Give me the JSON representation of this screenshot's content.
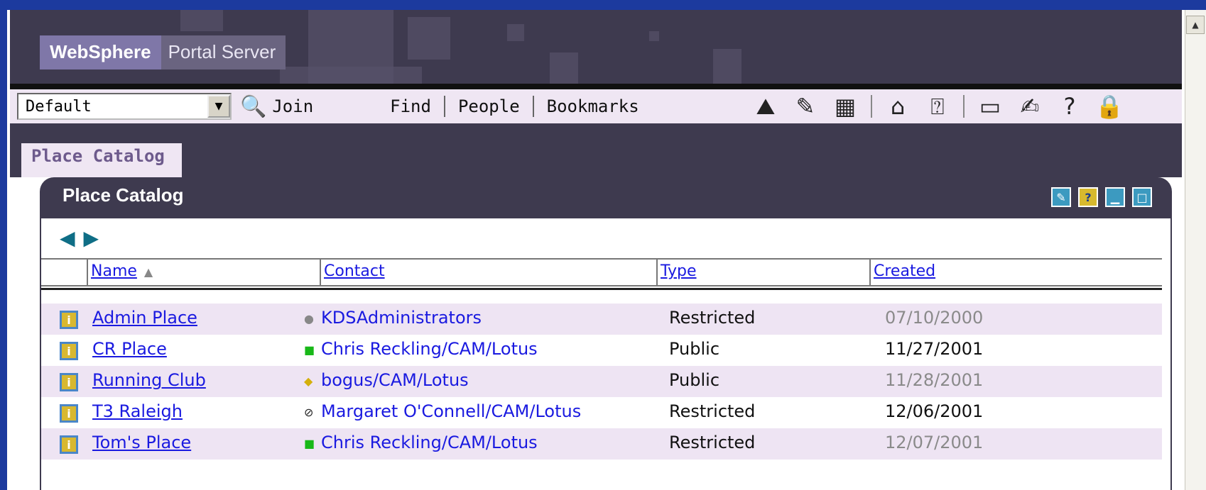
{
  "banner": {
    "brand_primary": "WebSphere",
    "brand_secondary": "Portal Server"
  },
  "toolbar": {
    "place_select_value": "Default",
    "join_label": "Join",
    "links": [
      "Find",
      "People",
      "Bookmarks"
    ],
    "icons": [
      "my-places-icon",
      "edit-page-icon",
      "layout-icon",
      "new-place-icon",
      "help-topics-icon",
      "open-folder-icon",
      "customize-icon",
      "help-icon",
      "lock-icon"
    ]
  },
  "tab": {
    "label": "Place Catalog"
  },
  "portlet": {
    "title": "Place Catalog",
    "columns": {
      "name": "Name",
      "contact": "Contact",
      "type": "Type",
      "created": "Created"
    },
    "rows": [
      {
        "name": "Admin Place",
        "contact": "KDSAdministrators",
        "contact_icon": "dot-icon",
        "type": "Restricted",
        "created": "07/10/2000"
      },
      {
        "name": "CR Place",
        "contact": "Chris Reckling/CAM/Lotus",
        "contact_icon": "green-square-icon",
        "type": "Public",
        "created": "11/27/2001"
      },
      {
        "name": "Running Club",
        "contact": "bogus/CAM/Lotus",
        "contact_icon": "yellow-diamond-icon",
        "type": "Public",
        "created": "11/28/2001"
      },
      {
        "name": "T3 Raleigh",
        "contact": "Margaret O'Connell/CAM/Lotus",
        "contact_icon": "no-entry-icon",
        "type": "Restricted",
        "created": "12/06/2001"
      },
      {
        "name": "Tom's Place",
        "contact": "Chris Reckling/CAM/Lotus",
        "contact_icon": "green-square-icon",
        "type": "Restricted",
        "created": "12/07/2001"
      }
    ]
  },
  "colors": {
    "header_bg": "#3e3a4f",
    "toolbar_bg": "#efe6f3",
    "row_alt_bg": "#eee4f3",
    "link": "#1a1ae0",
    "desktop": "#1c3a9e"
  }
}
